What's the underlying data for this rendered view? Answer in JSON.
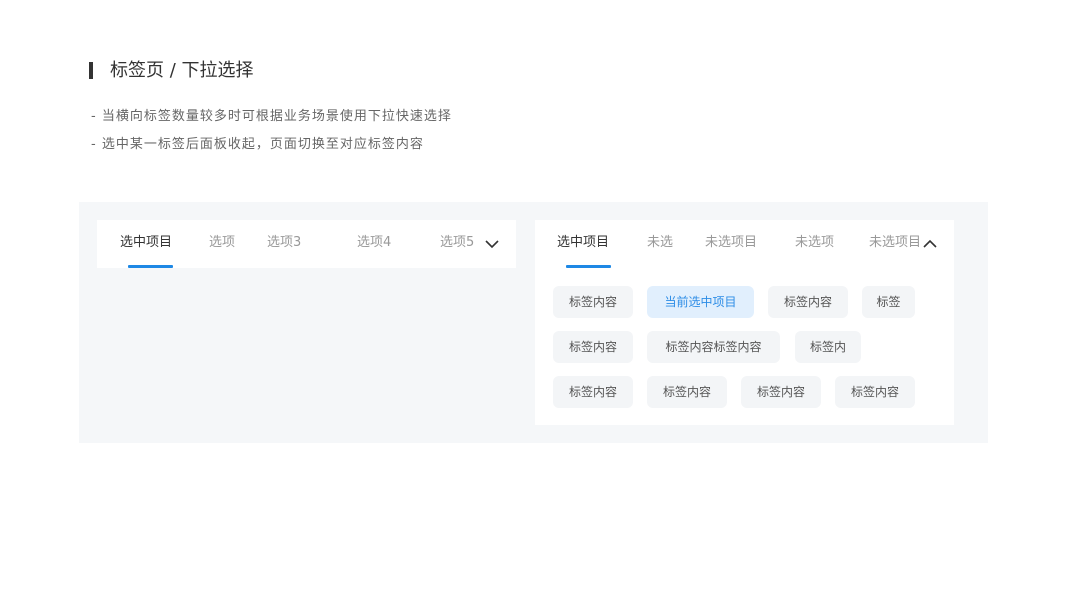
{
  "header": {
    "title": "标签页 / 下拉选择",
    "desc1": "- 当横向标签数量较多时可根据业务场景使用下拉快速选择",
    "desc2": "- 选中某一标签后面板收起，页面切换至对应标签内容"
  },
  "left_panel": {
    "tabs": [
      "选中项目",
      "选项",
      "选项3",
      "选项4",
      "选项5"
    ],
    "expand_icon": "chevron-down-icon"
  },
  "right_panel": {
    "tabs": [
      "选中项目",
      "未选",
      "未选项目",
      "未选项",
      "未选项目"
    ],
    "collapse_icon": "chevron-up-icon",
    "chips": [
      "标签内容",
      "当前选中项目",
      "标签内容",
      "标签",
      "标签内容",
      "标签内容标签内容",
      "标签内",
      "标签内容",
      "标签内容",
      "标签内容",
      "标签内容"
    ],
    "selected_chip": "当前选中项目"
  },
  "colors": {
    "accent": "#1e88e5",
    "selected_chip_bg": "#e1effd",
    "chip_bg": "#f3f5f7",
    "stage_bg": "#f5f7f9"
  }
}
